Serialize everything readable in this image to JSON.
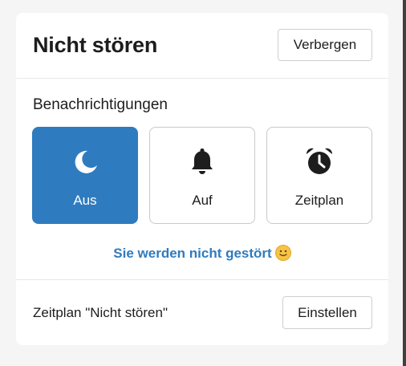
{
  "header": {
    "title": "Nicht stören",
    "hide_label": "Verbergen"
  },
  "notifications": {
    "label": "Benachrichtigungen",
    "options": [
      {
        "label": "Aus",
        "icon": "moon-icon",
        "selected": true
      },
      {
        "label": "Auf",
        "icon": "bell-icon",
        "selected": false
      },
      {
        "label": "Zeitplan",
        "icon": "alarm-clock-icon",
        "selected": false
      }
    ],
    "status_text": "Sie werden nicht gestört",
    "status_emoji": "slightly-smiling-face-icon"
  },
  "schedule": {
    "label": "Zeitplan \"Nicht stören\"",
    "button_label": "Einstellen"
  },
  "colors": {
    "accent": "#2f7bbf",
    "text": "#1d1d1d",
    "border": "#c9c9c9"
  }
}
